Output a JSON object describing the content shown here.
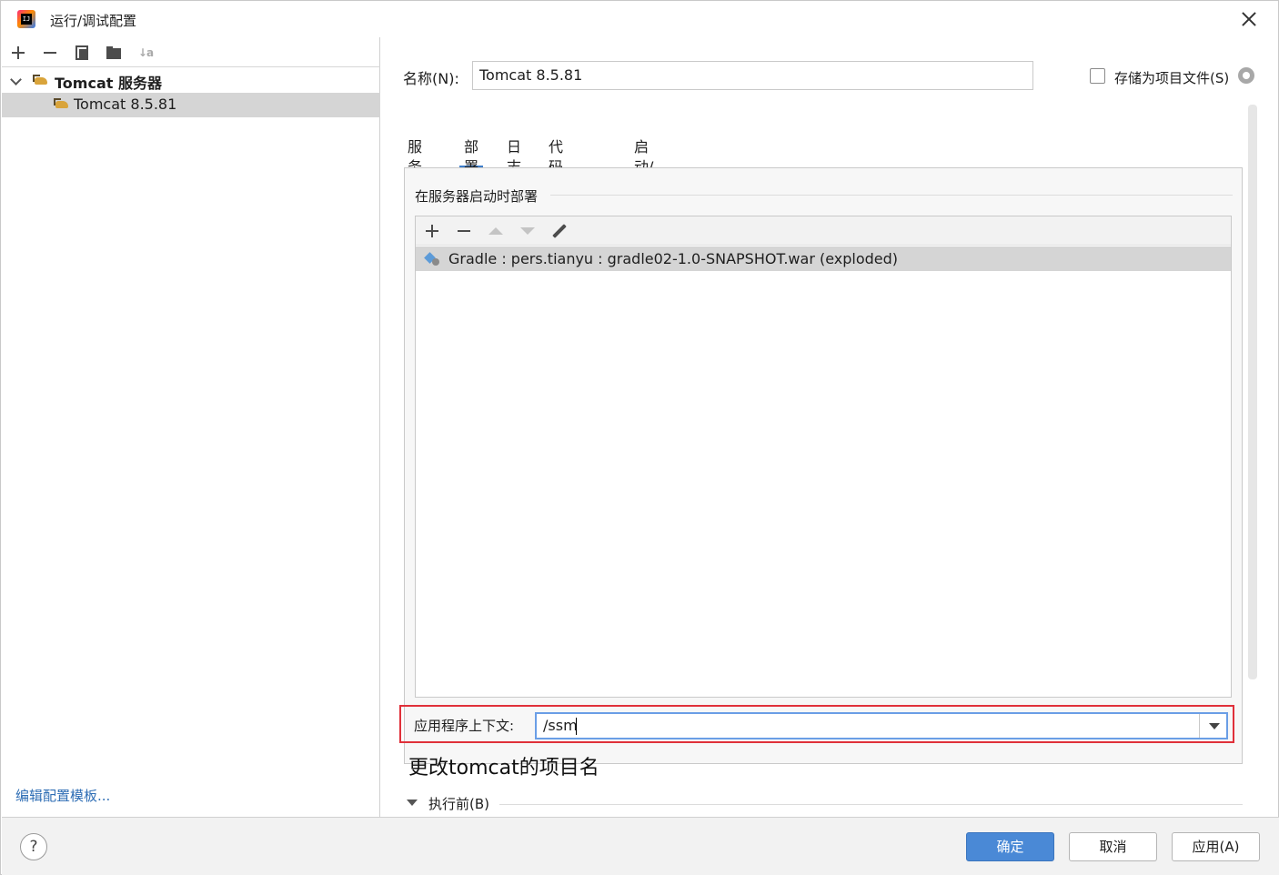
{
  "window": {
    "title": "运行/调试配置"
  },
  "tree": {
    "group_label": "Tomcat 服务器",
    "item_label": "Tomcat 8.5.81"
  },
  "left_footer": {
    "edit_templates": "编辑配置模板..."
  },
  "form": {
    "name_label": "名称(N):",
    "name_value": "Tomcat 8.5.81",
    "store_as_project_file": "存储为项目文件(S)",
    "store_checked": false
  },
  "tabs": [
    {
      "label": "服务器",
      "active": false
    },
    {
      "label": "部署",
      "active": true
    },
    {
      "label": "日志",
      "active": false
    },
    {
      "label": "代码覆盖率",
      "active": false
    },
    {
      "label": "启动/连接",
      "active": false
    }
  ],
  "deploy": {
    "group_title": "在服务器启动时部署",
    "items": [
      {
        "label": "Gradle : pers.tianyu : gradle02-1.0-SNAPSHOT.war (exploded)"
      }
    ],
    "context_label": "应用程序上下文:",
    "context_value": "/ssm"
  },
  "annotation": "更改tomcat的项目名",
  "before_launch": {
    "label": "执行前(B)"
  },
  "buttons": {
    "help": "?",
    "ok": "确定",
    "cancel": "取消",
    "apply": "应用(A)"
  },
  "colors": {
    "accent": "#4a89d6",
    "highlight_border": "#e0303a",
    "link": "#2f6eb5",
    "selection": "#d5d5d5"
  }
}
